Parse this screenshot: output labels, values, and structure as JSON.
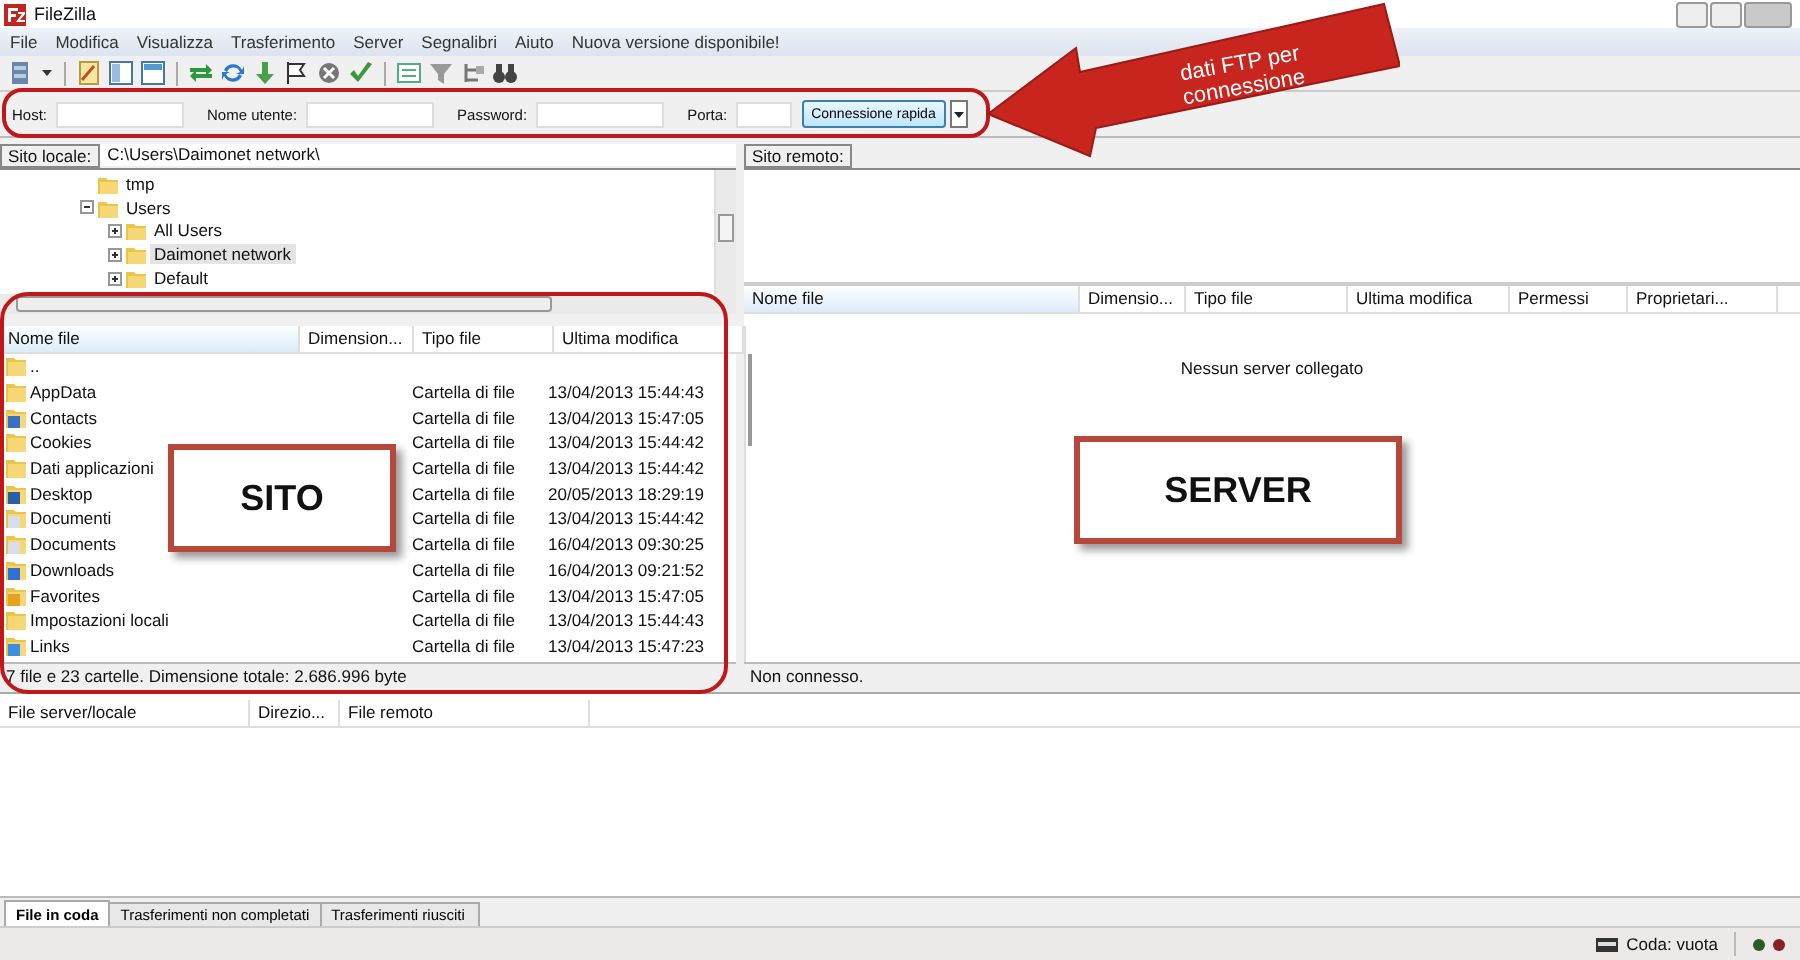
{
  "window": {
    "title": "FileZilla"
  },
  "menu": [
    "File",
    "Modifica",
    "Visualizza",
    "Trasferimento",
    "Server",
    "Segnalibri",
    "Aiuto",
    "Nuova versione disponibile!"
  ],
  "quickconnect": {
    "fields": [
      {
        "label": "Host:"
      },
      {
        "label": "Nome utente:"
      },
      {
        "label": "Password:"
      },
      {
        "label": "Porta:"
      }
    ],
    "button": "Connessione rapida"
  },
  "local": {
    "site_label": "Sito locale:",
    "path": "C:\\Users\\Daimonet network\\",
    "tree": [
      {
        "name": "tmp",
        "has_children": false,
        "selected": false
      },
      {
        "name": "Users",
        "has_children": true,
        "expanded": true,
        "selected": false,
        "children": [
          {
            "name": "All Users",
            "has_children": true,
            "expanded": false,
            "selected": false
          },
          {
            "name": "Daimonet network",
            "has_children": true,
            "expanded": false,
            "selected": true
          },
          {
            "name": "Default",
            "has_children": true,
            "expanded": false,
            "selected": false
          }
        ]
      }
    ],
    "columns": [
      "Nome file",
      "Dimension...",
      "Tipo file",
      "Ultima modifica"
    ],
    "rows": [
      {
        "kind": "folder",
        "name": "..",
        "type": "",
        "modified": ""
      },
      {
        "kind": "folder",
        "name": "AppData",
        "type": "Cartella di file",
        "modified": "13/04/2013 15:44:43"
      },
      {
        "kind": "contacts",
        "name": "Contacts",
        "type": "Cartella di file",
        "modified": "13/04/2013 15:47:05"
      },
      {
        "kind": "folder",
        "name": "Cookies",
        "type": "Cartella di file",
        "modified": "13/04/2013 15:44:42"
      },
      {
        "kind": "folder",
        "name": "Dati applicazioni",
        "type": "Cartella di file",
        "modified": "13/04/2013 15:44:42"
      },
      {
        "kind": "desktop",
        "name": "Desktop",
        "type": "Cartella di file",
        "modified": "20/05/2013 18:29:19"
      },
      {
        "kind": "documents",
        "name": "Documenti",
        "type": "Cartella di file",
        "modified": "13/04/2013 15:44:42"
      },
      {
        "kind": "documents",
        "name": "Documents",
        "type": "Cartella di file",
        "modified": "16/04/2013 09:30:25"
      },
      {
        "kind": "downloads",
        "name": "Downloads",
        "type": "Cartella di file",
        "modified": "16/04/2013 09:21:52"
      },
      {
        "kind": "favorites",
        "name": "Favorites",
        "type": "Cartella di file",
        "modified": "13/04/2013 15:47:05"
      },
      {
        "kind": "folder",
        "name": "Impostazioni locali",
        "type": "Cartella di file",
        "modified": "13/04/2013 15:44:43"
      },
      {
        "kind": "links",
        "name": "Links",
        "type": "Cartella di file",
        "modified": "13/04/2013 15:47:23"
      }
    ],
    "status": "7 file e 23 cartelle. Dimensione totale: 2.686.996 byte"
  },
  "remote": {
    "site_label": "Sito remoto:",
    "columns": [
      "Nome file",
      "Dimensio...",
      "Tipo file",
      "Ultima modifica",
      "Permessi",
      "Proprietari..."
    ],
    "message": "Nessun server collegato",
    "status": "Non connesso."
  },
  "queue": {
    "columns": [
      "File server/locale",
      "Direzio...",
      "File remoto"
    ]
  },
  "tabs": [
    {
      "label": "File in coda",
      "selected": true
    },
    {
      "label": "Trasferimenti non completati",
      "selected": false
    },
    {
      "label": "Trasferimenti riusciti",
      "selected": false
    }
  ],
  "status_bar": {
    "queue": "Coda: vuota"
  },
  "annotations": [
    {
      "kind": "arrow",
      "text": "dati FTP per connessione"
    },
    {
      "kind": "box",
      "text": "SITO"
    },
    {
      "kind": "box",
      "text": "SERVER"
    }
  ]
}
